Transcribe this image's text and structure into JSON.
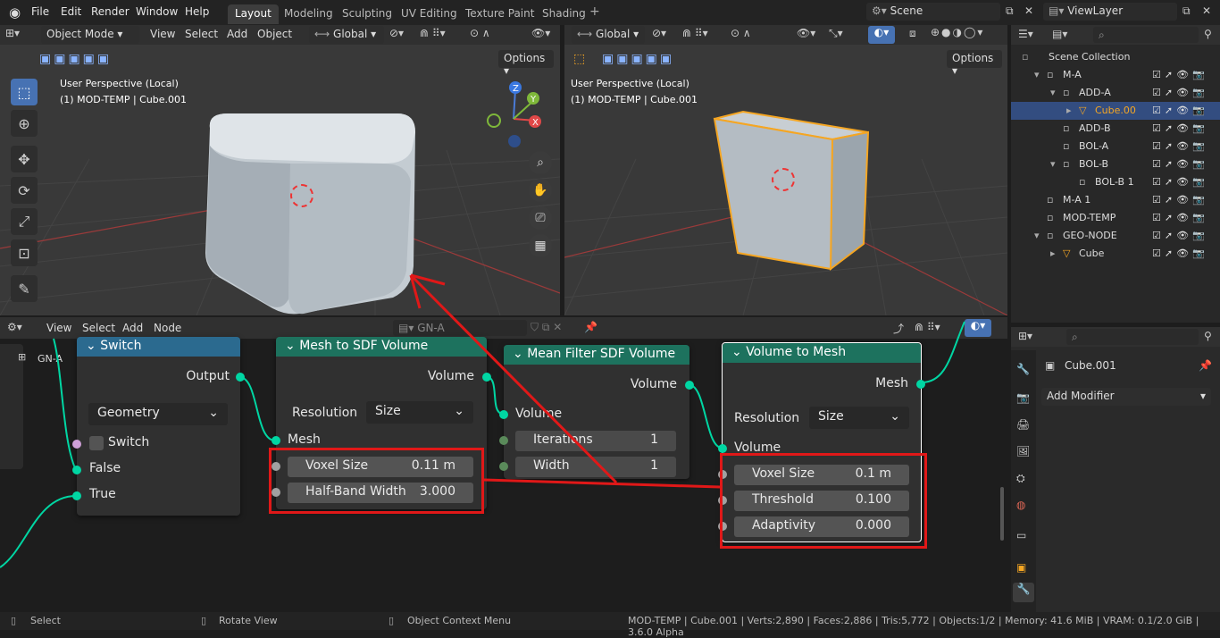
{
  "topbar": {
    "menus": [
      "File",
      "Edit",
      "Render",
      "Window",
      "Help"
    ],
    "workspaces": [
      "Layout",
      "Modeling",
      "Sculpting",
      "UV Editing",
      "Texture Paint",
      "Shading"
    ],
    "active_workspace": "Layout",
    "scene": "Scene",
    "view_layer": "ViewLayer"
  },
  "viewport_left": {
    "mode": "Object Mode",
    "menus": [
      "View",
      "Select",
      "Add",
      "Object"
    ],
    "orientation": "Global",
    "options": "Options",
    "perspective": "User Perspective (Local)",
    "object_info": "(1) MOD-TEMP | Cube.001"
  },
  "viewport_right": {
    "orientation": "Global",
    "options": "Options",
    "perspective": "User Perspective (Local)",
    "object_info": "(1) MOD-TEMP | Cube.001"
  },
  "outliner": {
    "title": "Scene Collection",
    "items": [
      {
        "label": "M-A",
        "selected": false
      },
      {
        "label": "ADD-A",
        "selected": false
      },
      {
        "label": "Cube.00",
        "selected": true
      },
      {
        "label": "ADD-B",
        "selected": false
      },
      {
        "label": "BOL-A",
        "selected": false
      },
      {
        "label": "BOL-B",
        "selected": false
      },
      {
        "label": "BOL-B 1",
        "selected": false
      },
      {
        "label": "M-A 1",
        "selected": false
      },
      {
        "label": "MOD-TEMP",
        "selected": false
      },
      {
        "label": "GEO-NODE",
        "selected": false
      },
      {
        "label": "Cube",
        "selected": false
      }
    ]
  },
  "node_editor": {
    "menus": [
      "View",
      "Select",
      "Add",
      "Node"
    ],
    "node_group": "GN-A",
    "breadcrumb": "GN-A",
    "nodes": {
      "switch": {
        "title": "Switch",
        "output": "Output",
        "type": "Geometry",
        "switch_label": "Switch",
        "false_label": "False",
        "true_label": "True"
      },
      "mesh_to_sdf": {
        "title": "Mesh to SDF Volume",
        "output": "Volume",
        "resolution_label": "Resolution",
        "resolution_value": "Size",
        "input": "Mesh",
        "voxel_label": "Voxel Size",
        "voxel_value": "0.11 m",
        "halfband_label": "Half-Band Width",
        "halfband_value": "3.000"
      },
      "mean_filter": {
        "title": "Mean Filter SDF Volume",
        "output": "Volume",
        "input": "Volume",
        "iter_label": "Iterations",
        "iter_value": "1",
        "width_label": "Width",
        "width_value": "1"
      },
      "volume_to_mesh": {
        "title": "Volume to Mesh",
        "output": "Mesh",
        "resolution_label": "Resolution",
        "resolution_value": "Size",
        "input": "Volume",
        "voxel_label": "Voxel Size",
        "voxel_value": "0.1 m",
        "threshold_label": "Threshold",
        "threshold_value": "0.100",
        "adaptivity_label": "Adaptivity",
        "adaptivity_value": "0.000"
      }
    }
  },
  "properties": {
    "object": "Cube.001",
    "add_modifier": "Add Modifier"
  },
  "status": {
    "select": "Select",
    "rotate": "Rotate View",
    "context": "Object Context Menu",
    "stats": "MOD-TEMP | Cube.001 | Verts:2,890 | Faces:2,886 | Tris:5,772 | Objects:1/2 | Memory: 41.6 MiB | VRAM: 0.1/2.0 GiB | 3.6.0 Alpha"
  },
  "colors": {
    "accent": "#4772b3",
    "geo_node_header": "#1d725e",
    "switch_header": "#2b6a8f",
    "socket_geo": "#00d6a3",
    "annotation_red": "#e01818",
    "selection_orange": "#f5a623"
  }
}
